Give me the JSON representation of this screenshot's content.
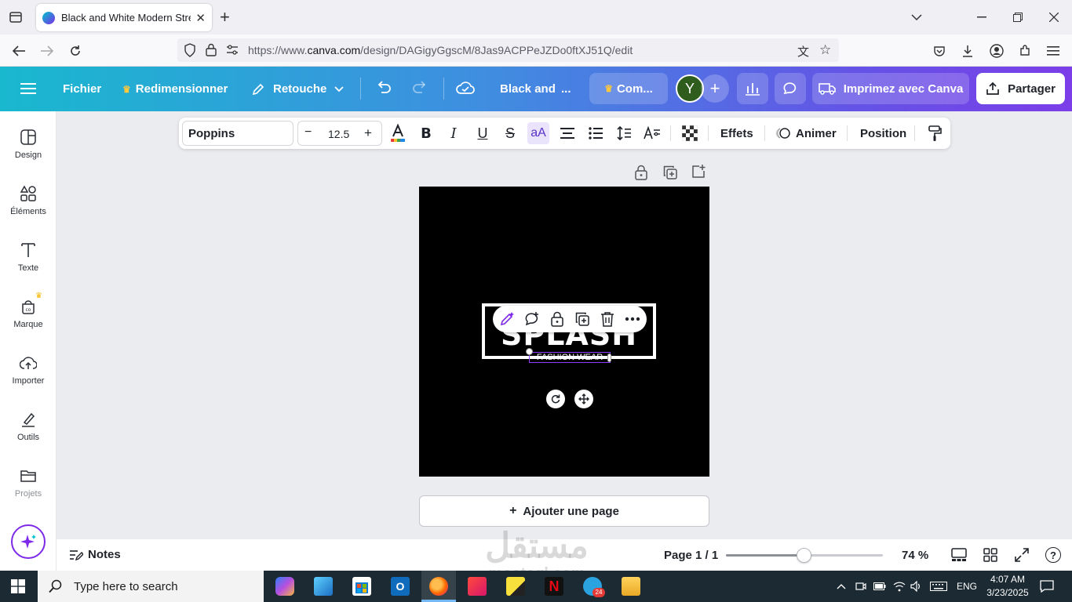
{
  "browser": {
    "tab_title": "Black and White Modern Streetwear",
    "new_tab": "+",
    "url_prefix": "https://www.",
    "url_domain": "canva.com",
    "url_path": "/design/DAGigyGgscM/8Jas9ACPPeJZDo0ftXJ51Q/edit"
  },
  "canva_bar": {
    "menu_icon": "hamburger-icon",
    "file": "Fichier",
    "resize": "Redimensionner",
    "edit": "Retouche",
    "title": "Black and",
    "title_more": "...",
    "premium": "Com...",
    "avatar": "Y",
    "print": "Imprimez avec Canva",
    "share": "Partager",
    "colors": {
      "gradient_start": "#19b8cf",
      "gradient_end": "#7b3ee8",
      "avatar_bg": "#2f5d1e"
    }
  },
  "sidebar": {
    "items": [
      {
        "label": "Design",
        "icon": "design-icon"
      },
      {
        "label": "Éléments",
        "icon": "elements-icon"
      },
      {
        "label": "Texte",
        "icon": "text-icon"
      },
      {
        "label": "Marque",
        "icon": "brand-icon"
      },
      {
        "label": "Importer",
        "icon": "upload-icon"
      },
      {
        "label": "Outils",
        "icon": "tools-icon"
      },
      {
        "label": "Projets",
        "icon": "folder-icon"
      }
    ]
  },
  "text_toolbar": {
    "font": "Poppins",
    "minus": "−",
    "font_size": "12.5",
    "plus": "+",
    "case": "aA",
    "effects": "Effets",
    "animate": "Animer",
    "position": "Position"
  },
  "canvas": {
    "headline": "SPLASH",
    "subline": "FASHION WEAR",
    "add_page": "Ajouter une page"
  },
  "bottom": {
    "notes": "Notes",
    "page_indicator": "Page 1 / 1",
    "zoom": "74 %",
    "zoom_slider_fraction": 0.5
  },
  "watermark": {
    "arabic": "مستقل",
    "latin": "mostaql.com"
  },
  "taskbar": {
    "search_placeholder": "Type here to search",
    "telegram_badge": "24",
    "language": "ENG",
    "time": "4:07 AM",
    "date": "3/23/2025"
  }
}
